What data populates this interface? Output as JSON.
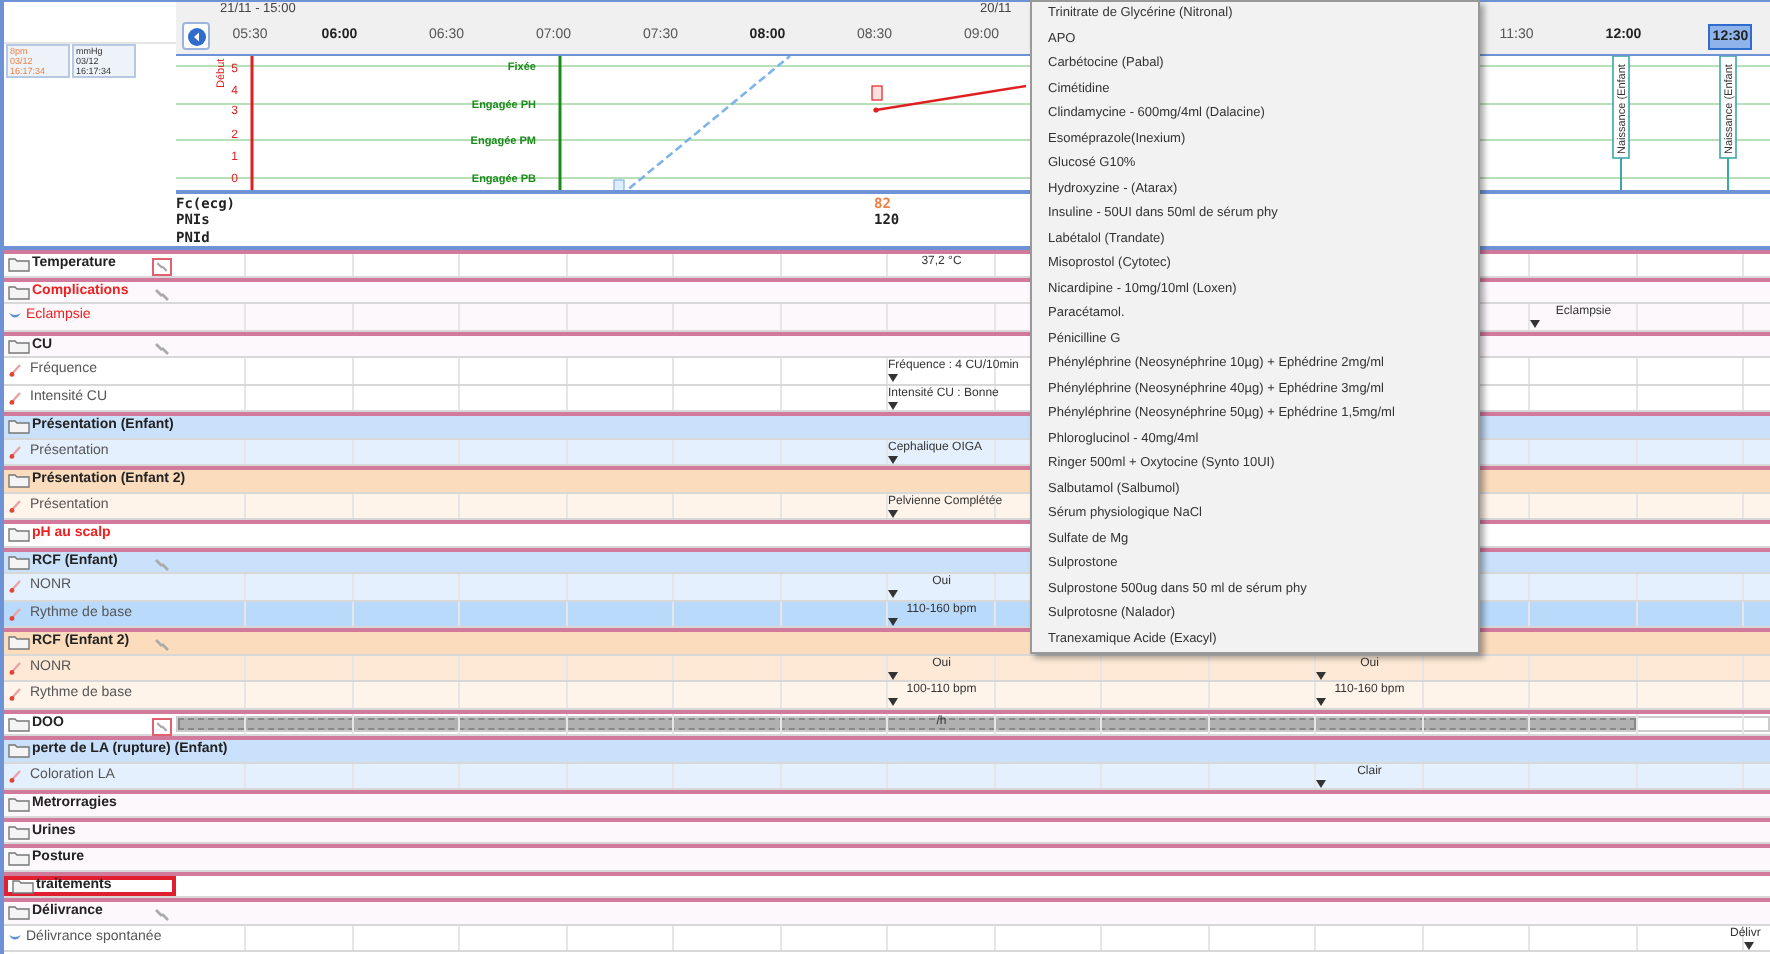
{
  "header": {
    "date": "21/11 - 15:00",
    "date_right": "20/11"
  },
  "times": [
    {
      "label": "05:30",
      "bold": false,
      "current": false
    },
    {
      "label": "06:00",
      "bold": true,
      "current": false
    },
    {
      "label": "06:30",
      "bold": false,
      "current": false
    },
    {
      "label": "07:00",
      "bold": false,
      "current": false
    },
    {
      "label": "07:30",
      "bold": false,
      "current": false
    },
    {
      "label": "08:00",
      "bold": true,
      "current": false
    },
    {
      "label": "08:30",
      "bold": false,
      "current": false
    },
    {
      "label": "09:00",
      "bold": false,
      "current": false
    },
    {
      "label": "11:30",
      "bold": false,
      "current": false
    },
    {
      "label": "12:00",
      "bold": true,
      "current": false
    },
    {
      "label": "12:30",
      "bold": true,
      "current": true
    }
  ],
  "readings": [
    {
      "lines": [
        "8pm",
        "03/12",
        "16:17:34"
      ],
      "alert": true
    },
    {
      "lines": [
        "mmHg",
        "03/12",
        "16:17:34"
      ],
      "alert": false
    }
  ],
  "partogram": {
    "y_labels": [
      "5",
      "4",
      "3",
      "2",
      "1",
      "0"
    ],
    "stations": [
      "Fixée",
      "Engagée PH",
      "Engagée PM",
      "Engagée PB"
    ],
    "start_label": "Début",
    "births": [
      {
        "kind": "blank"
      },
      {
        "kind": "blank"
      },
      {
        "kind": "blank"
      },
      {
        "kind": "blank"
      },
      {
        "kind": "blank"
      },
      {
        "kind": "blank"
      },
      {
        "kind": "blank"
      },
      {
        "kind": "blank"
      },
      {
        "kind": "blank"
      },
      {
        "kind": "blank"
      },
      {
        "kind": "blank"
      },
      {
        "kind": "blank"
      },
      {
        "kind": "blank"
      },
      {
        "kind": "blank"
      },
      {
        "kind": "birth",
        "label": "Naissance (Enfant"
      },
      {
        "kind": "birth",
        "label": "Naissance (Enfant"
      }
    ]
  },
  "vitals": [
    {
      "label": "Fc(ecg)",
      "value": "82",
      "color": "#f08040"
    },
    {
      "label": "PNIs",
      "value": "120",
      "color": "#222222"
    },
    {
      "label": "PNId"
    }
  ],
  "rows": [
    {
      "kind": "group",
      "label": "Temperature",
      "color": "#ffffff",
      "alert": false,
      "selected": false,
      "link": true,
      "link_framed": true,
      "cells": [
        {
          "kind": "blank"
        },
        {
          "kind": "blank"
        },
        {
          "kind": "blank"
        },
        {
          "kind": "blank"
        },
        {
          "kind": "blank"
        },
        {
          "kind": "blank"
        },
        {
          "kind": "blank"
        },
        {
          "kind": "value",
          "text": "37,2 °C",
          "marker": false
        }
      ]
    },
    {
      "kind": "group",
      "label": "Complications",
      "color": "#fdf8fc",
      "alert": true,
      "selected": false,
      "link": true,
      "link_framed": false
    },
    {
      "kind": "event",
      "label": "Eclampsie",
      "color": "#fdf8fc",
      "alert": true,
      "selected": false,
      "cells": [
        {
          "kind": "blank"
        },
        {
          "kind": "blank"
        },
        {
          "kind": "blank"
        },
        {
          "kind": "blank"
        },
        {
          "kind": "blank"
        },
        {
          "kind": "blank"
        },
        {
          "kind": "blank"
        },
        {
          "kind": "blank"
        },
        {
          "kind": "blank"
        },
        {
          "kind": "blank"
        },
        {
          "kind": "blank"
        },
        {
          "kind": "blank"
        },
        {
          "kind": "blank"
        },
        {
          "kind": "value",
          "text": "Eclampsie",
          "marker": true
        }
      ]
    },
    {
      "kind": "group",
      "label": "CU",
      "color": "#fdf8fc",
      "alert": false,
      "selected": false,
      "link": true,
      "link_framed": false
    },
    {
      "kind": "item",
      "label": "Fréquence",
      "color": "#ffffff",
      "alert": false,
      "selected": false,
      "cells": [
        {
          "kind": "blank"
        },
        {
          "kind": "blank"
        },
        {
          "kind": "blank"
        },
        {
          "kind": "blank"
        },
        {
          "kind": "blank"
        },
        {
          "kind": "blank"
        },
        {
          "kind": "blank"
        },
        {
          "kind": "value",
          "text": "Fréquence : 4 CU/10min",
          "marker": true
        }
      ]
    },
    {
      "kind": "item",
      "label": "Intensité CU",
      "color": "#ffffff",
      "alert": false,
      "selected": false,
      "cells": [
        {
          "kind": "blank"
        },
        {
          "kind": "blank"
        },
        {
          "kind": "blank"
        },
        {
          "kind": "blank"
        },
        {
          "kind": "blank"
        },
        {
          "kind": "blank"
        },
        {
          "kind": "blank"
        },
        {
          "kind": "value",
          "text": "Intensité CU : Bonne",
          "marker": true
        }
      ]
    },
    {
      "kind": "group",
      "label": "Présentation (Enfant)",
      "color": "#c9e1fb",
      "alert": false,
      "selected": false
    },
    {
      "kind": "item",
      "label": "Présentation",
      "color": "#e4f0fd",
      "alert": false,
      "selected": false,
      "cells": [
        {
          "kind": "blank"
        },
        {
          "kind": "blank"
        },
        {
          "kind": "blank"
        },
        {
          "kind": "blank"
        },
        {
          "kind": "blank"
        },
        {
          "kind": "blank"
        },
        {
          "kind": "blank"
        },
        {
          "kind": "value",
          "text": "Cephalique OIGA",
          "marker": true
        }
      ]
    },
    {
      "kind": "group",
      "label": "Présentation (Enfant 2)",
      "color": "#fbdcbd",
      "alert": false,
      "selected": false
    },
    {
      "kind": "item",
      "label": "Présentation",
      "color": "#fff4ea",
      "alert": false,
      "selected": false,
      "cells": [
        {
          "kind": "blank"
        },
        {
          "kind": "blank"
        },
        {
          "kind": "blank"
        },
        {
          "kind": "blank"
        },
        {
          "kind": "blank"
        },
        {
          "kind": "blank"
        },
        {
          "kind": "blank"
        },
        {
          "kind": "value",
          "text": "Pelvienne Complétée",
          "marker": true
        }
      ]
    },
    {
      "kind": "group",
      "label": "pH au scalp",
      "color": "#ffffff",
      "alert": true,
      "selected": false
    },
    {
      "kind": "group",
      "label": "RCF (Enfant)",
      "color": "#c9e1fb",
      "alert": false,
      "selected": false,
      "link": true,
      "link_framed": false
    },
    {
      "kind": "item",
      "label": "NONR",
      "color": "#e4f0fd",
      "alert": false,
      "selected": false,
      "cells": [
        {
          "kind": "blank"
        },
        {
          "kind": "blank"
        },
        {
          "kind": "blank"
        },
        {
          "kind": "blank"
        },
        {
          "kind": "blank"
        },
        {
          "kind": "blank"
        },
        {
          "kind": "blank"
        },
        {
          "kind": "value",
          "text": "Oui",
          "marker": true
        }
      ]
    },
    {
      "kind": "item",
      "label": "Rythme de base",
      "color": "#b9dafb",
      "alert": false,
      "selected": false,
      "cells": [
        {
          "kind": "blank"
        },
        {
          "kind": "blank"
        },
        {
          "kind": "blank"
        },
        {
          "kind": "blank"
        },
        {
          "kind": "blank"
        },
        {
          "kind": "blank"
        },
        {
          "kind": "blank"
        },
        {
          "kind": "value",
          "text": "110-160 bpm",
          "marker": true
        }
      ]
    },
    {
      "kind": "group",
      "label": "RCF (Enfant 2)",
      "color": "#fbdcbd",
      "alert": false,
      "selected": false,
      "link": true,
      "link_framed": false
    },
    {
      "kind": "item",
      "label": "NONR",
      "color": "#fde9d6",
      "alert": false,
      "selected": false,
      "cells": [
        {
          "kind": "blank"
        },
        {
          "kind": "blank"
        },
        {
          "kind": "blank"
        },
        {
          "kind": "blank"
        },
        {
          "kind": "blank"
        },
        {
          "kind": "blank"
        },
        {
          "kind": "blank"
        },
        {
          "kind": "value",
          "text": "Oui",
          "marker": true
        },
        {
          "kind": "blank"
        },
        {
          "kind": "blank"
        },
        {
          "kind": "blank"
        },
        {
          "kind": "value",
          "text": "Oui",
          "marker": true
        }
      ]
    },
    {
      "kind": "item",
      "label": "Rythme de base",
      "color": "#fff4ea",
      "alert": false,
      "selected": false,
      "cells": [
        {
          "kind": "blank"
        },
        {
          "kind": "blank"
        },
        {
          "kind": "blank"
        },
        {
          "kind": "blank"
        },
        {
          "kind": "blank"
        },
        {
          "kind": "blank"
        },
        {
          "kind": "blank"
        },
        {
          "kind": "value",
          "text": "100-110 bpm",
          "marker": true
        },
        {
          "kind": "blank"
        },
        {
          "kind": "blank"
        },
        {
          "kind": "blank"
        },
        {
          "kind": "value",
          "text": "110-160 bpm",
          "marker": true
        }
      ]
    },
    {
      "kind": "group",
      "label": "DOO",
      "color": "#ffffff",
      "alert": false,
      "selected": false,
      "link": true,
      "link_framed": true,
      "level": 0.917,
      "cells": [
        {
          "kind": "blank"
        },
        {
          "kind": "blank"
        },
        {
          "kind": "blank"
        },
        {
          "kind": "blank"
        },
        {
          "kind": "blank"
        },
        {
          "kind": "blank"
        },
        {
          "kind": "blank"
        },
        {
          "kind": "value",
          "text": "/h",
          "marker": false
        }
      ]
    },
    {
      "kind": "group",
      "label": "perte de LA (rupture) (Enfant)",
      "color": "#c9e1fb",
      "alert": false,
      "selected": false
    },
    {
      "kind": "item",
      "label": "Coloration LA",
      "color": "#e4f0fd",
      "alert": false,
      "selected": false,
      "cells": [
        {
          "kind": "blank"
        },
        {
          "kind": "blank"
        },
        {
          "kind": "blank"
        },
        {
          "kind": "blank"
        },
        {
          "kind": "blank"
        },
        {
          "kind": "blank"
        },
        {
          "kind": "blank"
        },
        {
          "kind": "blank"
        },
        {
          "kind": "blank"
        },
        {
          "kind": "blank"
        },
        {
          "kind": "blank"
        },
        {
          "kind": "value",
          "text": "Clair",
          "marker": true
        }
      ]
    },
    {
      "kind": "group",
      "label": "Metrorragies",
      "color": "#fdf8fc",
      "alert": false,
      "selected": false
    },
    {
      "kind": "group",
      "label": "Urines",
      "color": "#fdf8fc",
      "alert": false,
      "selected": false
    },
    {
      "kind": "group",
      "label": "Posture",
      "color": "#fdf8fc",
      "alert": false,
      "selected": false
    },
    {
      "kind": "group",
      "label": "traitements",
      "color": "#ffffff",
      "alert": false,
      "selected": true
    },
    {
      "kind": "group",
      "label": "Délivrance",
      "color": "#fdf8fc",
      "alert": false,
      "selected": false,
      "link": true,
      "link_framed": false
    },
    {
      "kind": "event",
      "label": "Délivrance spontanée",
      "color": "#ffffff",
      "alert": false,
      "selected": false,
      "cells": [
        {
          "kind": "blank"
        },
        {
          "kind": "blank"
        },
        {
          "kind": "blank"
        },
        {
          "kind": "blank"
        },
        {
          "kind": "blank"
        },
        {
          "kind": "blank"
        },
        {
          "kind": "blank"
        },
        {
          "kind": "blank"
        },
        {
          "kind": "blank"
        },
        {
          "kind": "blank"
        },
        {
          "kind": "blank"
        },
        {
          "kind": "blank"
        },
        {
          "kind": "blank"
        },
        {
          "kind": "blank"
        },
        {
          "kind": "blank"
        },
        {
          "kind": "value",
          "text": "Délivr",
          "marker": true
        }
      ]
    }
  ],
  "dropdown": {
    "items": [
      "Trinitrate de Glycérine (Nitronal)",
      "APO",
      "Carbétocine (Pabal)",
      "Cimétidine",
      "Clindamycine - 600mg/4ml (Dalacine)",
      "Esoméprazole(Inexium)",
      "Glucosé G10%",
      "Hydroxyzine - (Atarax)",
      "Insuline - 50UI dans 50ml de sérum phy",
      "Labétalol (Trandate)",
      "Misoprostol (Cytotec)",
      "Nicardipine - 10mg/10ml (Loxen)",
      "Paracétamol.",
      "Pénicilline G",
      "Phényléphrine (Neosynéphrine 10µg) + Ephédrine 2mg/ml",
      "Phényléphrine (Neosynéphrine 40µg) + Ephédrine 3mg/ml",
      "Phényléphrine (Neosynéphrine 50µg) + Ephédrine 1,5mg/ml",
      "Phloroglucinol - 40mg/4ml",
      "Ringer 500ml + Oxytocine (Synto 10UI)",
      "Salbutamol (Salbumol)",
      "Sérum physiologique NaCl",
      "Sulfate de Mg",
      "Sulprostone",
      "Sulprostone 500ug dans 50 ml de sérum phy",
      "Sulprotosne (Nalador)",
      "Tranexamique Acide (Exacyl)"
    ]
  }
}
